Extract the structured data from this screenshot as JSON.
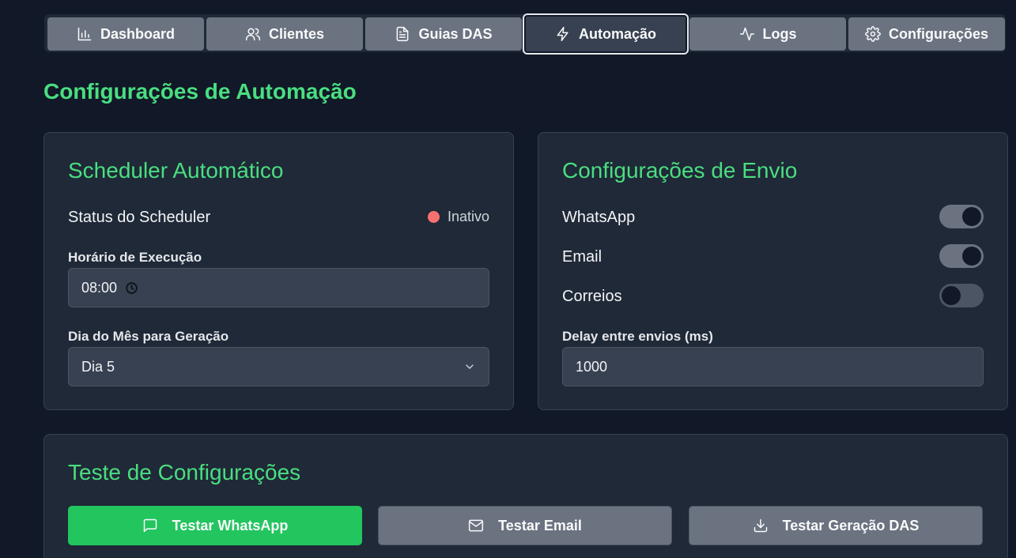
{
  "tabs": [
    {
      "label": "Dashboard",
      "icon": "bar-chart-icon"
    },
    {
      "label": "Clientes",
      "icon": "users-icon"
    },
    {
      "label": "Guias DAS",
      "icon": "file-text-icon"
    },
    {
      "label": "Automação",
      "icon": "zap-icon",
      "active": true
    },
    {
      "label": "Logs",
      "icon": "activity-icon"
    },
    {
      "label": "Configurações",
      "icon": "gear-icon"
    }
  ],
  "page_title": "Configurações de Automação",
  "scheduler": {
    "title": "Scheduler Automático",
    "status_label": "Status do Scheduler",
    "status_value": "Inativo",
    "time_label": "Horário de Execução",
    "time_value": "08:00",
    "day_label": "Dia do Mês para Geração",
    "day_value": "Dia 5"
  },
  "envio": {
    "title": "Configurações de Envio",
    "whatsapp_label": "WhatsApp",
    "whatsapp_enabled": true,
    "email_label": "Email",
    "email_enabled": true,
    "correios_label": "Correios",
    "correios_enabled": false,
    "delay_label": "Delay entre envios (ms)",
    "delay_value": "1000"
  },
  "teste": {
    "title": "Teste de Configurações",
    "whatsapp_button": "Testar WhatsApp",
    "email_button": "Testar Email",
    "das_button": "Testar Geração DAS"
  },
  "colors": {
    "accent": "#4ade80",
    "primary_button": "#22c55e",
    "status_inactive": "#f87171",
    "background": "#111827",
    "card": "#1f2937"
  }
}
